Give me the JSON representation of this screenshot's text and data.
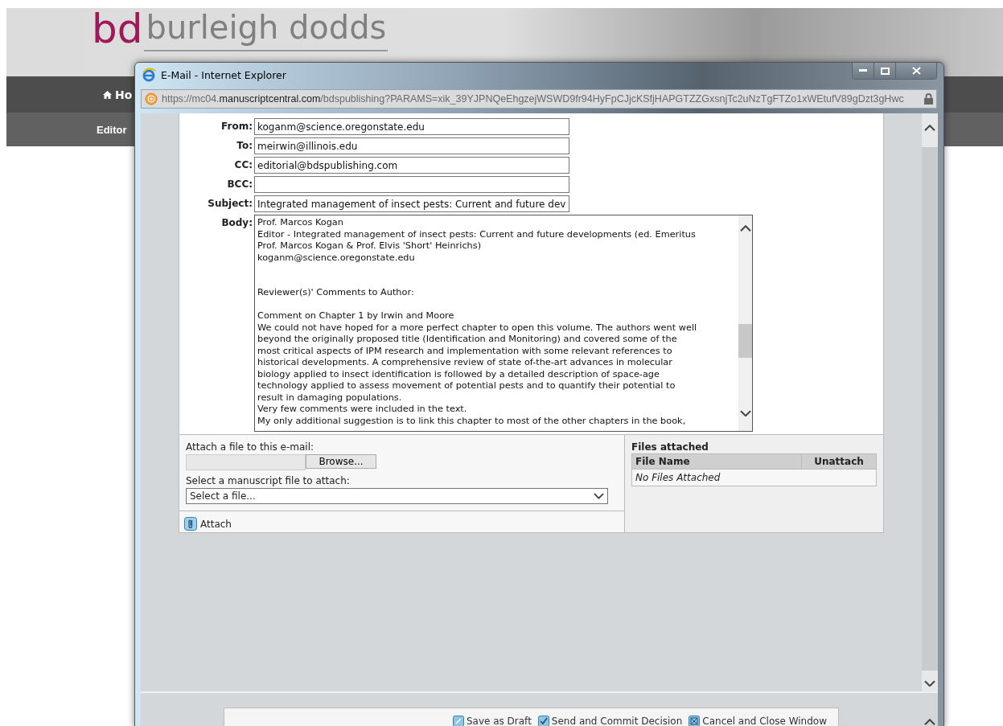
{
  "site": {
    "logo_mark": "bd",
    "logo_name": "burleigh dodds",
    "nav": [
      {
        "label": "Ho",
        "kind": "home"
      }
    ],
    "subnav": [
      "Editor"
    ]
  },
  "window": {
    "title": "E-Mail - Internet Explorer",
    "url_prefix": "https://mc04.",
    "url_domain": "manuscriptcentral.com",
    "url_rest": "/bdspublishing?PARAMS=xik_39YJPNQeEhgzejWSWD9fr94HyFpCJjcKSfjHAPGTZZGxsnjTc2uNzTgFTZo1xWEtufV89gDzt3gHwc"
  },
  "fields": [
    {
      "label": "From:",
      "value": "koganm@science.oregonstate.edu"
    },
    {
      "label": "To:",
      "value": "meirwin@illinois.edu"
    },
    {
      "label": "CC:",
      "value": "editorial@bdspublishing.com"
    },
    {
      "label": "BCC:"
    },
    {
      "label": "Subject:",
      "value": "Integrated management of insect pests: Current and future dev"
    }
  ],
  "body": {
    "label": "Body:",
    "paragraphs": [
      {
        "lines": [
          "Prof. Marcos Kogan",
          "Editor - Integrated management of insect pests: Current and future developments (ed. Emeritus",
          "Prof. Marcos Kogan & Prof. Elvis 'Short' Heinrichs)",
          "koganm@science.oregonstate.edu"
        ]
      },
      {
        "lines": [
          "Reviewer(s)' Comments to Author:"
        ]
      },
      {
        "lines": [
          "Comment on Chapter 1 by Irwin and Moore",
          "We could not have hoped for a more perfect chapter to open this volume. The authors went well",
          "beyond the originally proposed title (Identification and Monitoring) and covered some of the",
          "most critical aspects of IPM research and implementation with some relevant references to",
          "historical developments.  A comprehensive review of state of-the-art advances in molecular",
          "biology applied to insect identification is followed by a detailed description of space-age",
          "technology applied to assess movement of potential pests and to quantify their potential to",
          "result in damaging populations.",
          "Very few comments were included in the text.",
          "My only additional suggestion is to link this chapter to most of the other chapters in the book,"
        ]
      }
    ]
  },
  "attach": {
    "file_label": "Attach a file to this e-mail:",
    "browse": "Browse...",
    "manuscript_label": "Select a manuscript file to attach:",
    "select": "Select a file...",
    "attach_button": "Attach"
  },
  "files": {
    "title": "Files attached",
    "columns": [
      "File Name",
      "Unattach"
    ],
    "empty": "No Files Attached"
  },
  "actions": [
    {
      "label": "Save as Draft",
      "kind": "draft"
    },
    {
      "label": "Send and Commit Decision",
      "kind": "send"
    },
    {
      "label": "Cancel and Close Window",
      "kind": "cancel"
    }
  ]
}
